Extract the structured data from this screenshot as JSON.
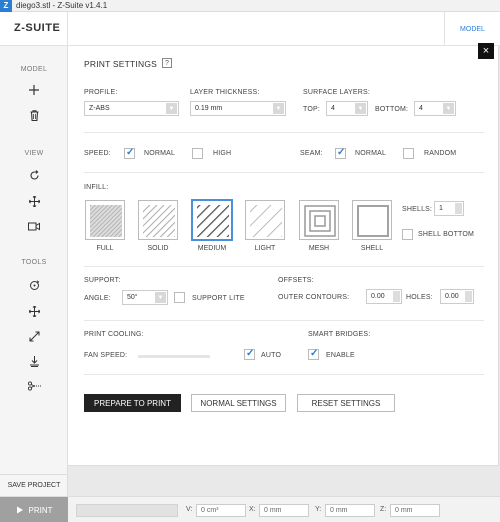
{
  "window": {
    "title": "diego3.stl - Z-Suite v1.4.1"
  },
  "header": {
    "logo": "Z-SUITE",
    "model_tab": "MODEL"
  },
  "sidebar": {
    "model_label": "MODEL",
    "view_label": "VIEW",
    "tools_label": "TOOLS",
    "save_project": "SAVE PROJECT"
  },
  "footer": {
    "print_label": "PRINT",
    "v_label": "V:",
    "v_value": "0 cm³",
    "x_label": "X:",
    "x_value": "0 mm",
    "y_label": "Y:",
    "y_value": "0 mm",
    "z_label": "Z:",
    "z_value": "0 mm"
  },
  "panel": {
    "title": "PRINT SETTINGS",
    "help": "?",
    "close": "×",
    "profile_label": "PROFILE:",
    "profile_value": "Z-ABS",
    "layer_label": "LAYER THICKNESS:",
    "layer_value": "0.19 mm",
    "surface_label": "SURFACE LAYERS:",
    "top_label": "TOP:",
    "top_value": "4",
    "bottom_label": "BOTTOM:",
    "bottom_value": "4",
    "speed_label": "SPEED:",
    "speed_normal": "NORMAL",
    "speed_high": "HIGH",
    "seam_label": "SEAM:",
    "seam_normal": "NORMAL",
    "seam_random": "RANDOM",
    "infill_label": "INFILL:",
    "infill_options": [
      "FULL",
      "SOLID",
      "MEDIUM",
      "LIGHT",
      "MESH",
      "SHELL"
    ],
    "shells_label": "SHELLS:",
    "shells_value": "1",
    "shell_bottom": "SHELL BOTTOM",
    "support_label": "SUPPORT:",
    "angle_label": "ANGLE:",
    "angle_value": "50°",
    "support_lite": "SUPPORT LITE",
    "offsets_label": "OFFSETS:",
    "outer_label": "OUTER CONTOURS:",
    "outer_value": "0.00",
    "holes_label": "HOLES:",
    "holes_value": "0.00",
    "cooling_label": "PRINT COOLING:",
    "fan_label": "FAN SPEED:",
    "auto_label": "AUTO",
    "bridges_label": "SMART BRIDGES:",
    "enable_label": "ENABLE",
    "prepare_btn": "PREPARE TO PRINT",
    "normal_btn": "NORMAL SETTINGS",
    "reset_btn": "RESET SETTINGS"
  },
  "state": {
    "speed": "normal",
    "seam": "normal",
    "infill_selected": "MEDIUM",
    "fan_speed_fraction": 0,
    "fan_auto": true,
    "smart_bridges": true,
    "support_lite": false,
    "shell_bottom": false
  }
}
